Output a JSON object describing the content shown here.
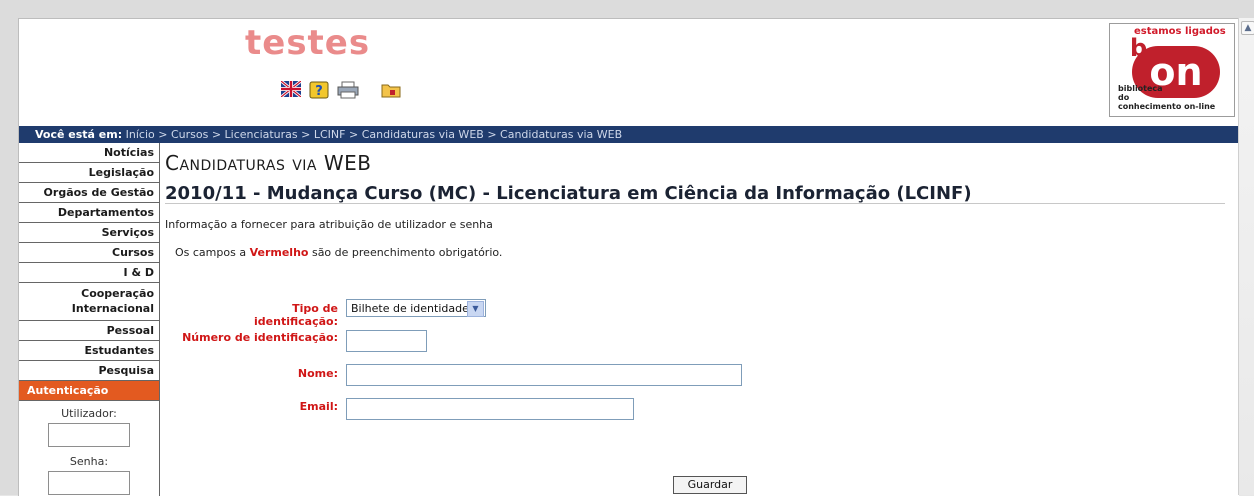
{
  "header": {
    "site_title": "testes",
    "icons": [
      "uk-flag-icon",
      "help-icon",
      "print-icon",
      "folder-icon"
    ],
    "logo": {
      "tagline": "estamos ligados",
      "wordmark": "on",
      "letter": "b",
      "caption_lines": [
        "biblioteca",
        "do",
        "conhecimento on-line"
      ]
    }
  },
  "breadcrumb": {
    "label": "Você está em:",
    "items": [
      "Início",
      "Cursos",
      "Licenciaturas",
      "LCINF",
      "Candidaturas via WEB",
      "Candidaturas via WEB"
    ],
    "separator": ">"
  },
  "sidebar": {
    "items": [
      {
        "label": "Notícias"
      },
      {
        "label": "Legislação"
      },
      {
        "label": "Orgãos de Gestão"
      },
      {
        "label": "Departamentos"
      },
      {
        "label": "Serviços"
      },
      {
        "label": "Cursos"
      },
      {
        "label": "I & D"
      },
      {
        "label": "Cooperação Internacional"
      },
      {
        "label": "Pessoal"
      },
      {
        "label": "Estudantes"
      },
      {
        "label": "Pesquisa"
      },
      {
        "label": "Autenticação"
      }
    ],
    "auth": {
      "user_label": "Utilizador:",
      "password_label": "Senha:",
      "user_value": "",
      "password_value": ""
    }
  },
  "main": {
    "heading": "Candidaturas via WEB",
    "subtitle": "2010/11 - Mudança Curso (MC) - Licenciatura em Ciência da Informação (LCINF)",
    "info": "Informação a fornecer para atribuição de utilizador e senha",
    "required_note": {
      "before": "Os campos a ",
      "highlight": "Vermelho",
      "after": " são de preenchimento obrigatório."
    },
    "form": {
      "id_type_label": "Tipo de identificação:",
      "id_type_value": "Bilhete de identidade",
      "id_number_label": "Número de identificação:",
      "id_number_value": "",
      "name_label": "Nome:",
      "name_value": "",
      "email_label": "Email:",
      "email_value": "",
      "save_label": "Guardar"
    }
  },
  "colors": {
    "nav_bar": "#1f3b6d",
    "active_menu": "#e35a20",
    "required": "#d01616",
    "title": "#ea8b8b"
  }
}
